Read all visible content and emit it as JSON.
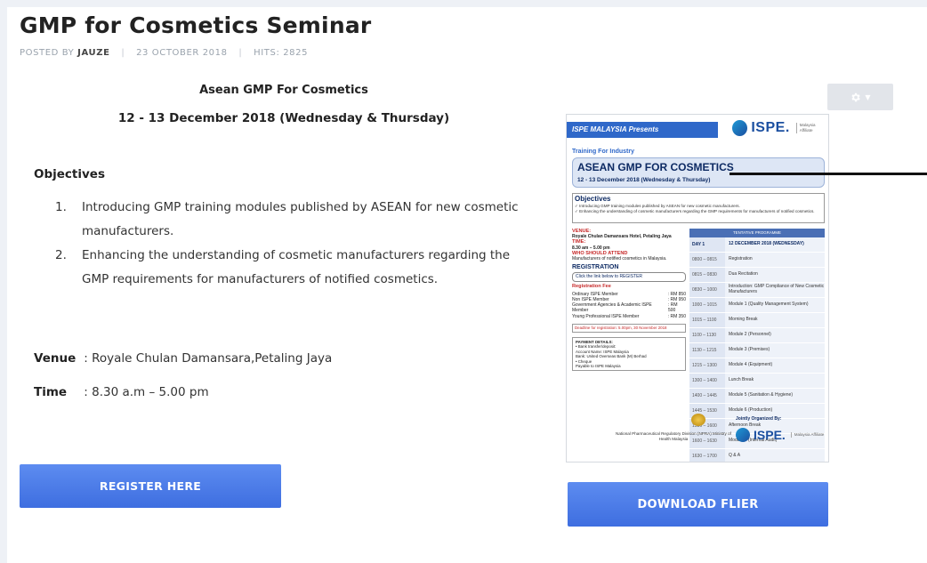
{
  "article": {
    "title": "GMP for Cosmetics Seminar",
    "posted_by_label": "POSTED BY",
    "author": "JAUZE",
    "date": "23 OCTOBER 2018",
    "hits": "HITS: 2825"
  },
  "event": {
    "heading": "Asean GMP For Cosmetics",
    "dates": "12 - 13 December 2018 (Wednesday & Thursday)"
  },
  "objectives": {
    "heading": "Objectives",
    "items": [
      {
        "num": "1.",
        "text": "Introducing GMP training modules published by ASEAN for new cosmetic manufacturers."
      },
      {
        "num": "2.",
        "text": "Enhancing the understanding of cosmetic manufacturers regarding the GMP requirements for manufacturers of notified cosmetics."
      }
    ]
  },
  "details": {
    "venue_label": "Venue",
    "venue_value": ": Royale Chulan Damansara,Petaling Jaya",
    "time_label": "Time",
    "time_value": ": 8.30 a.m – 5.00 pm"
  },
  "buttons": {
    "register": "REGISTER HERE",
    "download": "DOWNLOAD FLIER",
    "gear_icon": "gear-icon",
    "caret_icon": "caret-down-icon"
  },
  "flier": {
    "presents": "ISPE MALAYSIA Presents",
    "logo_text": "ISPE.",
    "logo_affiliate": "Malaysia Affiliate",
    "training": "Training For Industry",
    "title": "ASEAN GMP FOR COSMETICS",
    "dates": "12 - 13 December 2018 (Wednesday & Thursday)",
    "objectives_heading": "Objectives",
    "objectives": [
      "✓ Introducing GMP training modules published by ASEAN for new cosmetic manufacturers.",
      "✓ Enhancing the understanding of cosmetic manufacturers regarding the GMP requirements for manufacturers of notified cosmetics."
    ],
    "venue_label": "VENUE:",
    "venue": "Royale Chulan Damansara Hotel, Petaling Jaya",
    "time_label": "TIME:",
    "time": "8.30 am – 5.00 pm",
    "who_label": "WHO SHOULD ATTEND",
    "who": "Manufacturers of notified cosmetics in Malaysia.",
    "registration": "REGISTRATION",
    "reg_link": "Click the link below to REGISTER",
    "fee_label": "Registration Fee",
    "fees": [
      {
        "type": "Ordinary ISPE Member",
        "amount": ": RM 850"
      },
      {
        "type": "Non ISPE Member",
        "amount": ": RM 950"
      },
      {
        "type": "Government Agencies & Academic ISPE Member",
        "amount": ": RM 500"
      },
      {
        "type": "Young Professional ISPE Member",
        "amount": ": RM 350"
      }
    ],
    "deadline": "Deadline for registration: 5.00pm, 30 November 2018",
    "payment_heading": "PAYMENT DETAILS:",
    "payment_lines": [
      "• Bank transfer/deposit:",
      "Account Name: ISPE Malaysia",
      "Bank: United Overseas Bank (M) Berhad",
      "• Cheque",
      "Payable to ISPE Malaysia"
    ],
    "table_header": "TENTATIVE PROGRAMME",
    "schedule": [
      {
        "time": "DAY 1",
        "item": "12 DECEMBER 2018 (WEDNESDAY)"
      },
      {
        "time": "0800 – 0815",
        "item": "Registration"
      },
      {
        "time": "0815 – 0830",
        "item": "Dua Recitation"
      },
      {
        "time": "0830 – 1000",
        "item": "Introduction: GMP Compliance of New Cosmetic Manufacturers"
      },
      {
        "time": "1000 – 1015",
        "item": "Module 1 (Quality Management System)"
      },
      {
        "time": "1015 – 1100",
        "item": "Morning Break"
      },
      {
        "time": "1100 – 1130",
        "item": "Module 2 (Personnel)"
      },
      {
        "time": "1130 – 1215",
        "item": "Module 3 (Premises)"
      },
      {
        "time": "1215 – 1300",
        "item": "Module 4 (Equipment)"
      },
      {
        "time": "1300 – 1400",
        "item": "Lunch Break"
      },
      {
        "time": "1400 – 1445",
        "item": "Module 5 (Sanitation & Hygiene)"
      },
      {
        "time": "1445 – 1530",
        "item": "Module 6 (Production)"
      },
      {
        "time": "1530 – 1600",
        "item": "Afternoon Break"
      },
      {
        "time": "1600 – 1630",
        "item": "Module 7 (Internal Audit)"
      },
      {
        "time": "1630 – 1700",
        "item": "Q & A"
      }
    ],
    "jointly": "Jointly Organized By:",
    "org": "National Pharmaceutical Regulatory Division (NPRA) Ministry of Health Malaysia"
  }
}
